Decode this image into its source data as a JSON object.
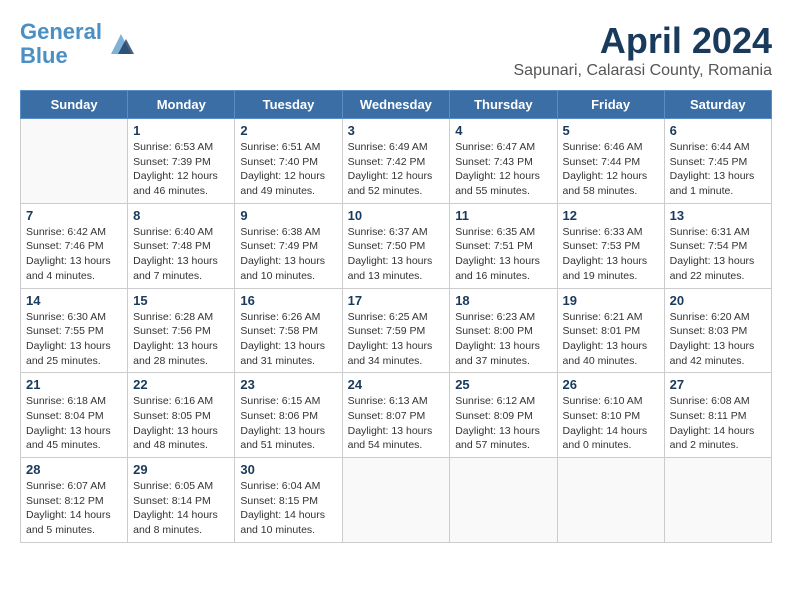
{
  "logo": {
    "line1": "General",
    "line2": "Blue"
  },
  "title": "April 2024",
  "subtitle": "Sapunari, Calarasi County, Romania",
  "days_header": [
    "Sunday",
    "Monday",
    "Tuesday",
    "Wednesday",
    "Thursday",
    "Friday",
    "Saturday"
  ],
  "weeks": [
    [
      {
        "day": "",
        "sunrise": "",
        "sunset": "",
        "daylight": ""
      },
      {
        "day": "1",
        "sunrise": "Sunrise: 6:53 AM",
        "sunset": "Sunset: 7:39 PM",
        "daylight": "Daylight: 12 hours and 46 minutes."
      },
      {
        "day": "2",
        "sunrise": "Sunrise: 6:51 AM",
        "sunset": "Sunset: 7:40 PM",
        "daylight": "Daylight: 12 hours and 49 minutes."
      },
      {
        "day": "3",
        "sunrise": "Sunrise: 6:49 AM",
        "sunset": "Sunset: 7:42 PM",
        "daylight": "Daylight: 12 hours and 52 minutes."
      },
      {
        "day": "4",
        "sunrise": "Sunrise: 6:47 AM",
        "sunset": "Sunset: 7:43 PM",
        "daylight": "Daylight: 12 hours and 55 minutes."
      },
      {
        "day": "5",
        "sunrise": "Sunrise: 6:46 AM",
        "sunset": "Sunset: 7:44 PM",
        "daylight": "Daylight: 12 hours and 58 minutes."
      },
      {
        "day": "6",
        "sunrise": "Sunrise: 6:44 AM",
        "sunset": "Sunset: 7:45 PM",
        "daylight": "Daylight: 13 hours and 1 minute."
      }
    ],
    [
      {
        "day": "7",
        "sunrise": "Sunrise: 6:42 AM",
        "sunset": "Sunset: 7:46 PM",
        "daylight": "Daylight: 13 hours and 4 minutes."
      },
      {
        "day": "8",
        "sunrise": "Sunrise: 6:40 AM",
        "sunset": "Sunset: 7:48 PM",
        "daylight": "Daylight: 13 hours and 7 minutes."
      },
      {
        "day": "9",
        "sunrise": "Sunrise: 6:38 AM",
        "sunset": "Sunset: 7:49 PM",
        "daylight": "Daylight: 13 hours and 10 minutes."
      },
      {
        "day": "10",
        "sunrise": "Sunrise: 6:37 AM",
        "sunset": "Sunset: 7:50 PM",
        "daylight": "Daylight: 13 hours and 13 minutes."
      },
      {
        "day": "11",
        "sunrise": "Sunrise: 6:35 AM",
        "sunset": "Sunset: 7:51 PM",
        "daylight": "Daylight: 13 hours and 16 minutes."
      },
      {
        "day": "12",
        "sunrise": "Sunrise: 6:33 AM",
        "sunset": "Sunset: 7:53 PM",
        "daylight": "Daylight: 13 hours and 19 minutes."
      },
      {
        "day": "13",
        "sunrise": "Sunrise: 6:31 AM",
        "sunset": "Sunset: 7:54 PM",
        "daylight": "Daylight: 13 hours and 22 minutes."
      }
    ],
    [
      {
        "day": "14",
        "sunrise": "Sunrise: 6:30 AM",
        "sunset": "Sunset: 7:55 PM",
        "daylight": "Daylight: 13 hours and 25 minutes."
      },
      {
        "day": "15",
        "sunrise": "Sunrise: 6:28 AM",
        "sunset": "Sunset: 7:56 PM",
        "daylight": "Daylight: 13 hours and 28 minutes."
      },
      {
        "day": "16",
        "sunrise": "Sunrise: 6:26 AM",
        "sunset": "Sunset: 7:58 PM",
        "daylight": "Daylight: 13 hours and 31 minutes."
      },
      {
        "day": "17",
        "sunrise": "Sunrise: 6:25 AM",
        "sunset": "Sunset: 7:59 PM",
        "daylight": "Daylight: 13 hours and 34 minutes."
      },
      {
        "day": "18",
        "sunrise": "Sunrise: 6:23 AM",
        "sunset": "Sunset: 8:00 PM",
        "daylight": "Daylight: 13 hours and 37 minutes."
      },
      {
        "day": "19",
        "sunrise": "Sunrise: 6:21 AM",
        "sunset": "Sunset: 8:01 PM",
        "daylight": "Daylight: 13 hours and 40 minutes."
      },
      {
        "day": "20",
        "sunrise": "Sunrise: 6:20 AM",
        "sunset": "Sunset: 8:03 PM",
        "daylight": "Daylight: 13 hours and 42 minutes."
      }
    ],
    [
      {
        "day": "21",
        "sunrise": "Sunrise: 6:18 AM",
        "sunset": "Sunset: 8:04 PM",
        "daylight": "Daylight: 13 hours and 45 minutes."
      },
      {
        "day": "22",
        "sunrise": "Sunrise: 6:16 AM",
        "sunset": "Sunset: 8:05 PM",
        "daylight": "Daylight: 13 hours and 48 minutes."
      },
      {
        "day": "23",
        "sunrise": "Sunrise: 6:15 AM",
        "sunset": "Sunset: 8:06 PM",
        "daylight": "Daylight: 13 hours and 51 minutes."
      },
      {
        "day": "24",
        "sunrise": "Sunrise: 6:13 AM",
        "sunset": "Sunset: 8:07 PM",
        "daylight": "Daylight: 13 hours and 54 minutes."
      },
      {
        "day": "25",
        "sunrise": "Sunrise: 6:12 AM",
        "sunset": "Sunset: 8:09 PM",
        "daylight": "Daylight: 13 hours and 57 minutes."
      },
      {
        "day": "26",
        "sunrise": "Sunrise: 6:10 AM",
        "sunset": "Sunset: 8:10 PM",
        "daylight": "Daylight: 14 hours and 0 minutes."
      },
      {
        "day": "27",
        "sunrise": "Sunrise: 6:08 AM",
        "sunset": "Sunset: 8:11 PM",
        "daylight": "Daylight: 14 hours and 2 minutes."
      }
    ],
    [
      {
        "day": "28",
        "sunrise": "Sunrise: 6:07 AM",
        "sunset": "Sunset: 8:12 PM",
        "daylight": "Daylight: 14 hours and 5 minutes."
      },
      {
        "day": "29",
        "sunrise": "Sunrise: 6:05 AM",
        "sunset": "Sunset: 8:14 PM",
        "daylight": "Daylight: 14 hours and 8 minutes."
      },
      {
        "day": "30",
        "sunrise": "Sunrise: 6:04 AM",
        "sunset": "Sunset: 8:15 PM",
        "daylight": "Daylight: 14 hours and 10 minutes."
      },
      {
        "day": "",
        "sunrise": "",
        "sunset": "",
        "daylight": ""
      },
      {
        "day": "",
        "sunrise": "",
        "sunset": "",
        "daylight": ""
      },
      {
        "day": "",
        "sunrise": "",
        "sunset": "",
        "daylight": ""
      },
      {
        "day": "",
        "sunrise": "",
        "sunset": "",
        "daylight": ""
      }
    ]
  ]
}
